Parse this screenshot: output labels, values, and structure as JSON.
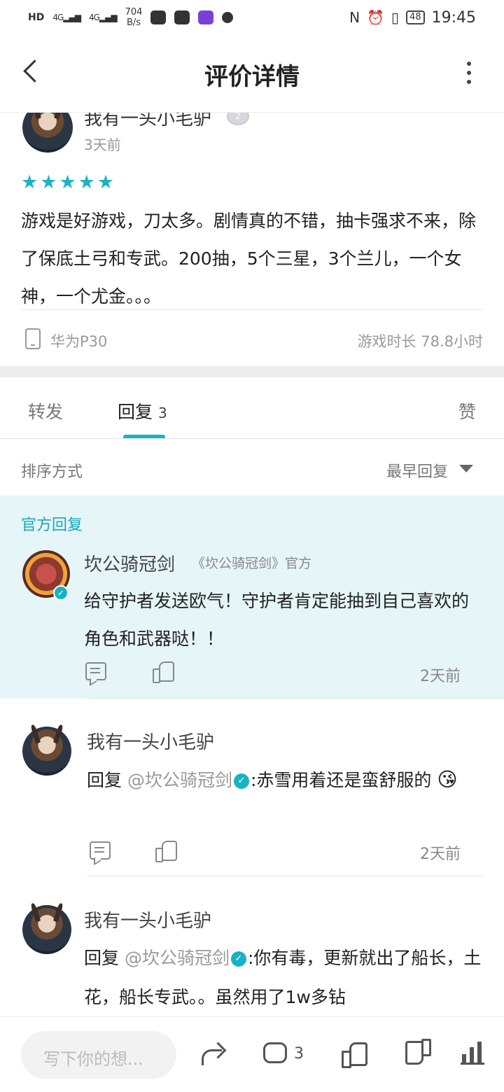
{
  "status_bar": {
    "network": "HD",
    "signal_1": "4G",
    "signal_2": "4G",
    "speed_value": "704",
    "speed_unit": "B/s",
    "battery": "48",
    "time": "19:45"
  },
  "header": {
    "title": "评价详情"
  },
  "review": {
    "author": "我有一头小毛驴",
    "level": "2",
    "time": "3天前",
    "stars": 5,
    "text": "游戏是好游戏，刀太多。剧情真的不错，抽卡强求不来，除了保底土弓和专武。200抽，5个三星，3个兰儿，一个女神，一个尤金。。。",
    "device": "华为P30",
    "playtime": "游戏时长 78.8小时"
  },
  "tabs": {
    "forward": "转发",
    "reply": "回复",
    "reply_count": "3",
    "like": "赞"
  },
  "sort": {
    "label": "排序方式",
    "value": "最早回复"
  },
  "official_reply": {
    "label": "官方回复",
    "name": "坎公骑冠剑",
    "tag": "《坎公骑冠剑》官方",
    "text": "给守护者发送欧气！守护者肯定能抽到自己喜欢的角色和武器哒！！",
    "time": "2天前"
  },
  "replies": [
    {
      "name": "我有一头小毛驴",
      "prefix": "回复",
      "mention": "@坎公骑冠剑",
      "text": ":赤雪用着还是蛮舒服的",
      "emoji": "😘",
      "time": "2天前"
    },
    {
      "name": "我有一头小毛驴",
      "prefix": "回复",
      "mention": "@坎公骑冠剑",
      "text": ":你有毒，更新就出了船长，土花，船长专武。。虽然用了1w多钻"
    }
  ],
  "bottom_bar": {
    "input_placeholder": "写下你的想...",
    "comment_count": "3"
  },
  "colors": {
    "accent": "#17b2c4",
    "official_bg": "#e6f5f8"
  }
}
